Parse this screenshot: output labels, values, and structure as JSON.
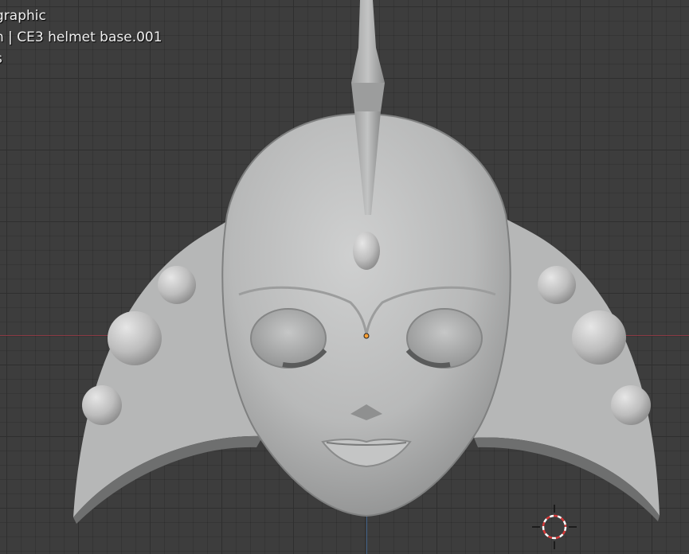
{
  "viewport": {
    "overlay": {
      "view_name": "graphic",
      "collection_object": "n | CE3 helmet base.001",
      "units": "s"
    },
    "object_name": "CE3 helmet base.001",
    "grid": true,
    "colors": {
      "background": "#3d3d3d",
      "x_axis": "#8a3a45",
      "y_axis": "#3f5f86",
      "mesh": "#bdbebe",
      "origin": "#ffa033",
      "cursor_red": "#d83a3a"
    },
    "icons": [
      "origin-icon",
      "3d-cursor-icon"
    ]
  }
}
